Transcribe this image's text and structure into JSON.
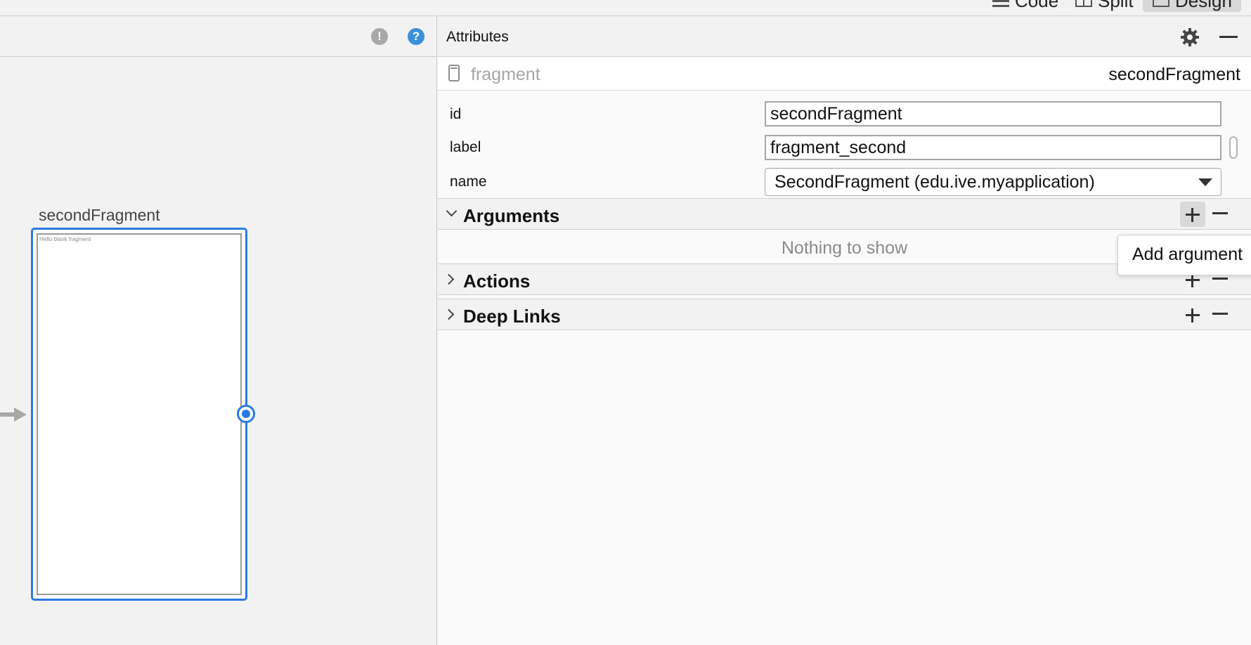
{
  "view_modes": {
    "code": "Code",
    "split": "Split",
    "design": "Design"
  },
  "canvas": {
    "destination_label": "secondFragment",
    "preview_text": "Hello blank fragment",
    "warning_icon": "!",
    "help_icon": "?"
  },
  "attributes": {
    "title": "Attributes",
    "component_type": "fragment",
    "component_id": "secondFragment",
    "fields": {
      "id_label": "id",
      "id_value": "secondFragment",
      "label_label": "label",
      "label_value": "fragment_second",
      "name_label": "name",
      "name_value": "SecondFragment (edu.ive.myapplication)"
    },
    "sections": {
      "arguments": "Arguments",
      "arguments_empty": "Nothing to show",
      "actions": "Actions",
      "deep_links": "Deep Links"
    },
    "popup": {
      "add_argument": "Add argument"
    }
  },
  "colors": {
    "accent": "#2a7ae4",
    "help": "#3b8fdc",
    "panel_bg": "#f2f2f2"
  }
}
